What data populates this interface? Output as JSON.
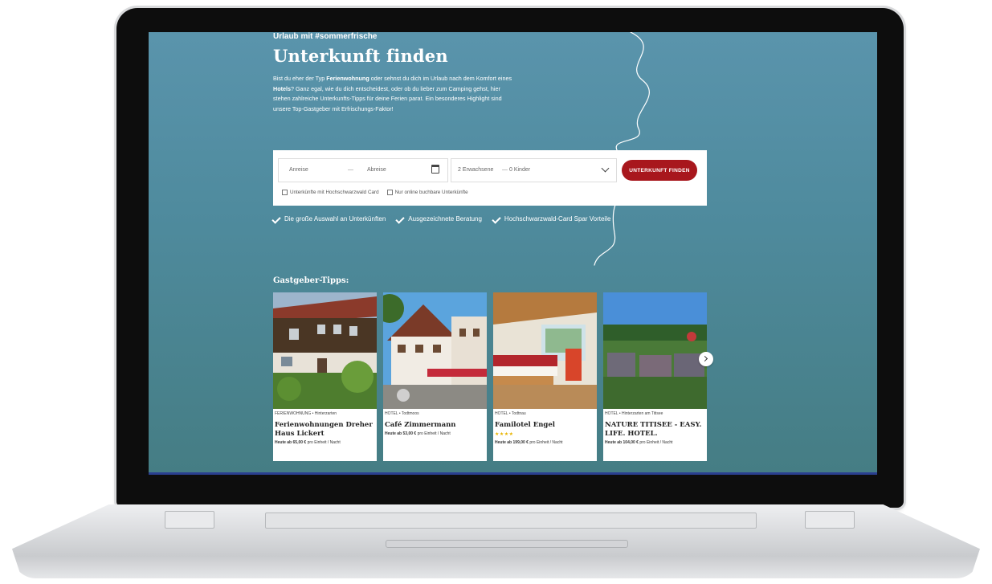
{
  "hero": {
    "hashtag": "Urlaub mit #sommerfrische",
    "title": "Unterkunft finden",
    "intro_1": "Bist du eher der Typ ",
    "intro_bold_1": "Ferienwohnung",
    "intro_2": " oder sehnst du dich im Urlaub nach dem Komfort eines ",
    "intro_bold_2": "Hotels",
    "intro_3": "? Ganz egal, wie du dich entscheidest, oder ob du lieber zum Camping gehst, hier stehen zahlreiche Unterkunfts-Tipps für deine Ferien parat. Ein besonderes Highlight sind unsere Top-Gastgeber mit Erfrischungs-Faktor!"
  },
  "search": {
    "arrival_label": "Anreise",
    "dash": "—",
    "departure_label": "Abreise",
    "adults_label": "2 Erwachsene",
    "children_label": "0 Kinder",
    "find_button": "UNTERKUNFT FINDEN",
    "option_card": "Unterkünfte mit Hochschwarzwald Card",
    "option_online": "Nur online buchbare Unterkünfte"
  },
  "benefits": [
    "Die große Auswahl an Unterkünften",
    "Ausgezeichnete Beratung",
    "Hochschwarzwald-Card Spar Vorteile"
  ],
  "section_heading": "Gastgeber-Tipps:",
  "cards": [
    {
      "category": "FERIENWOHNUNG • Hinterzarten",
      "name": "Ferienwohnungen Dreher Haus Lickert",
      "price_bold": "Heute ab 65,00 €",
      "price_rest": " pro Einheit / Nacht"
    },
    {
      "category": "HOTEL • Todtmoos",
      "name": "Café Zimmermann",
      "price_bold": "Heute ab 53,00 €",
      "price_rest": " pro Einheit / Nacht"
    },
    {
      "category": "HOTEL • Todtnau",
      "name": "Familotel Engel",
      "stars": "★★★★",
      "price_bold": "Heute ab 199,00 €",
      "price_rest": " pro Einheit / Nacht"
    },
    {
      "category": "HOTEL • Hinterzarten am Titisee",
      "name": "NATURE TITISEE - EASY. LIFE. HOTEL.",
      "price_bold": "Heute ab 104,00 €",
      "price_rest": " pro Einheit / Nacht"
    }
  ],
  "colors": {
    "accent_button": "#a8171d",
    "background_top": "#5a94ac",
    "background_bottom": "#457d84",
    "star": "#e8b400"
  },
  "icons": [
    "calendar-icon",
    "chevron-down-icon",
    "checkmark-icon",
    "chevron-right-icon"
  ]
}
